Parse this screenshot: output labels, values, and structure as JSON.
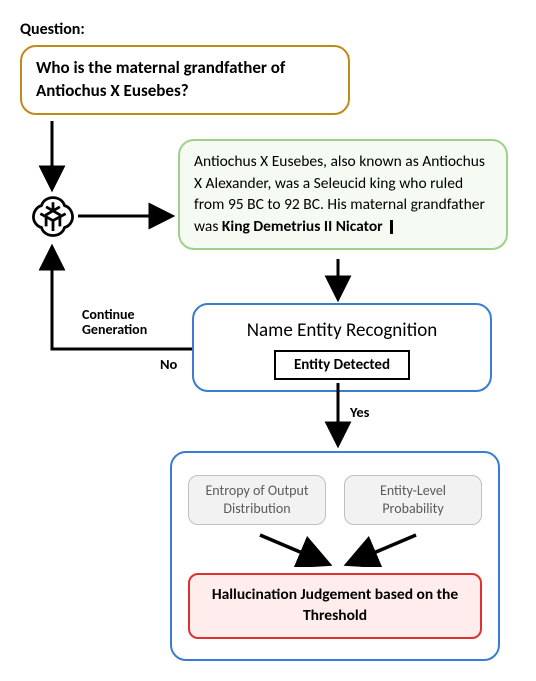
{
  "section_label": "Question:",
  "question": "Who is the maternal grandfather of Antiochus X Eusebes?",
  "generation": {
    "pre": "Antiochus X Eusebes, also known as Antiochus X Alexander, was a Seleucid king who ruled from 95 BC to 92 BC. His maternal grandfather was ",
    "entity": "King Demetrius II Nicator"
  },
  "ner": {
    "title": "Name Entity Recognition",
    "sub": "Entity Detected"
  },
  "labels": {
    "continue": "Continue Generation",
    "no": "No",
    "yes": "Yes"
  },
  "judge": {
    "left": "Entropy of Output Distribution",
    "right": "Entity-Level Probability",
    "result": "Hallucination Judgement based on the Threshold"
  },
  "icons": {
    "model": "openai-logo"
  },
  "chart_data": {
    "type": "diagram",
    "title": "Entity-level hallucination detection loop",
    "nodes": [
      {
        "id": "question",
        "label": "Who is the maternal grandfather of Antiochus X Eusebes?"
      },
      {
        "id": "model",
        "label": "LLM (OpenAI)"
      },
      {
        "id": "generation",
        "label": "Antiochus X Eusebes, also known as Antiochus X Alexander, was a Seleucid king who ruled from 95 BC to 92 BC. His maternal grandfather was King Demetrius II Nicator"
      },
      {
        "id": "ner",
        "label": "Name Entity Recognition",
        "sub": "Entity Detected"
      },
      {
        "id": "judge_inputs",
        "labels": [
          "Entropy of Output Distribution",
          "Entity-Level Probability"
        ]
      },
      {
        "id": "judge_result",
        "label": "Hallucination Judgement based on the Threshold"
      }
    ],
    "edges": [
      {
        "from": "question",
        "to": "model"
      },
      {
        "from": "model",
        "to": "generation"
      },
      {
        "from": "generation",
        "to": "ner"
      },
      {
        "from": "ner",
        "to": "model",
        "label": "No — Continue Generation"
      },
      {
        "from": "ner",
        "to": "judge_inputs",
        "label": "Yes"
      },
      {
        "from": "judge_inputs",
        "to": "judge_result"
      }
    ]
  }
}
